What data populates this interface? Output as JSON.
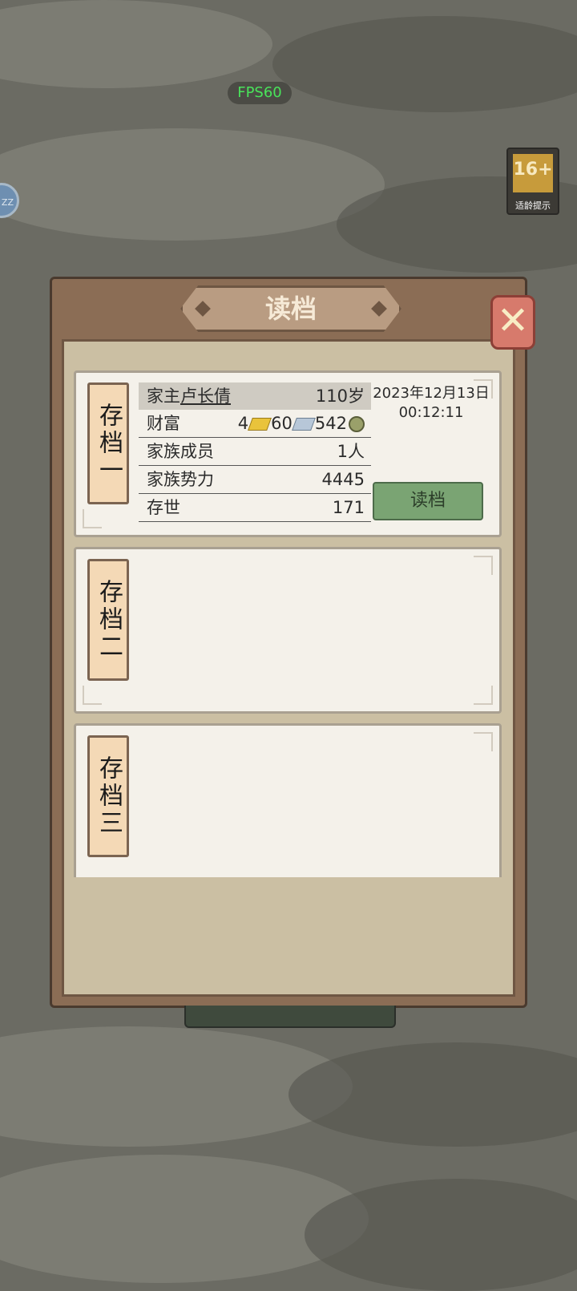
{
  "top": {
    "fps": "FPS60",
    "age_badge": {
      "rating": "16+",
      "caption": "适龄提示"
    },
    "left_orb": "ZZ"
  },
  "dialog": {
    "title": "读档",
    "close_icon": "close-x-icon",
    "slots": [
      {
        "label": "存档一",
        "head_label_prefix": "家主",
        "head_name": "卢长倩",
        "head_age": "110岁",
        "wealth_label": "财富",
        "wealth_gold": "4",
        "wealth_silver": "60",
        "wealth_coins": "542",
        "members_label": "家族成员",
        "members_value": "1人",
        "power_label": "家族势力",
        "power_value": "4445",
        "generation_label": "存世",
        "generation_value": "171",
        "date": "2023年12月13日",
        "time": "00:12:11",
        "load_button": "读档"
      },
      {
        "label": "存档二"
      },
      {
        "label": "存档三"
      }
    ]
  }
}
